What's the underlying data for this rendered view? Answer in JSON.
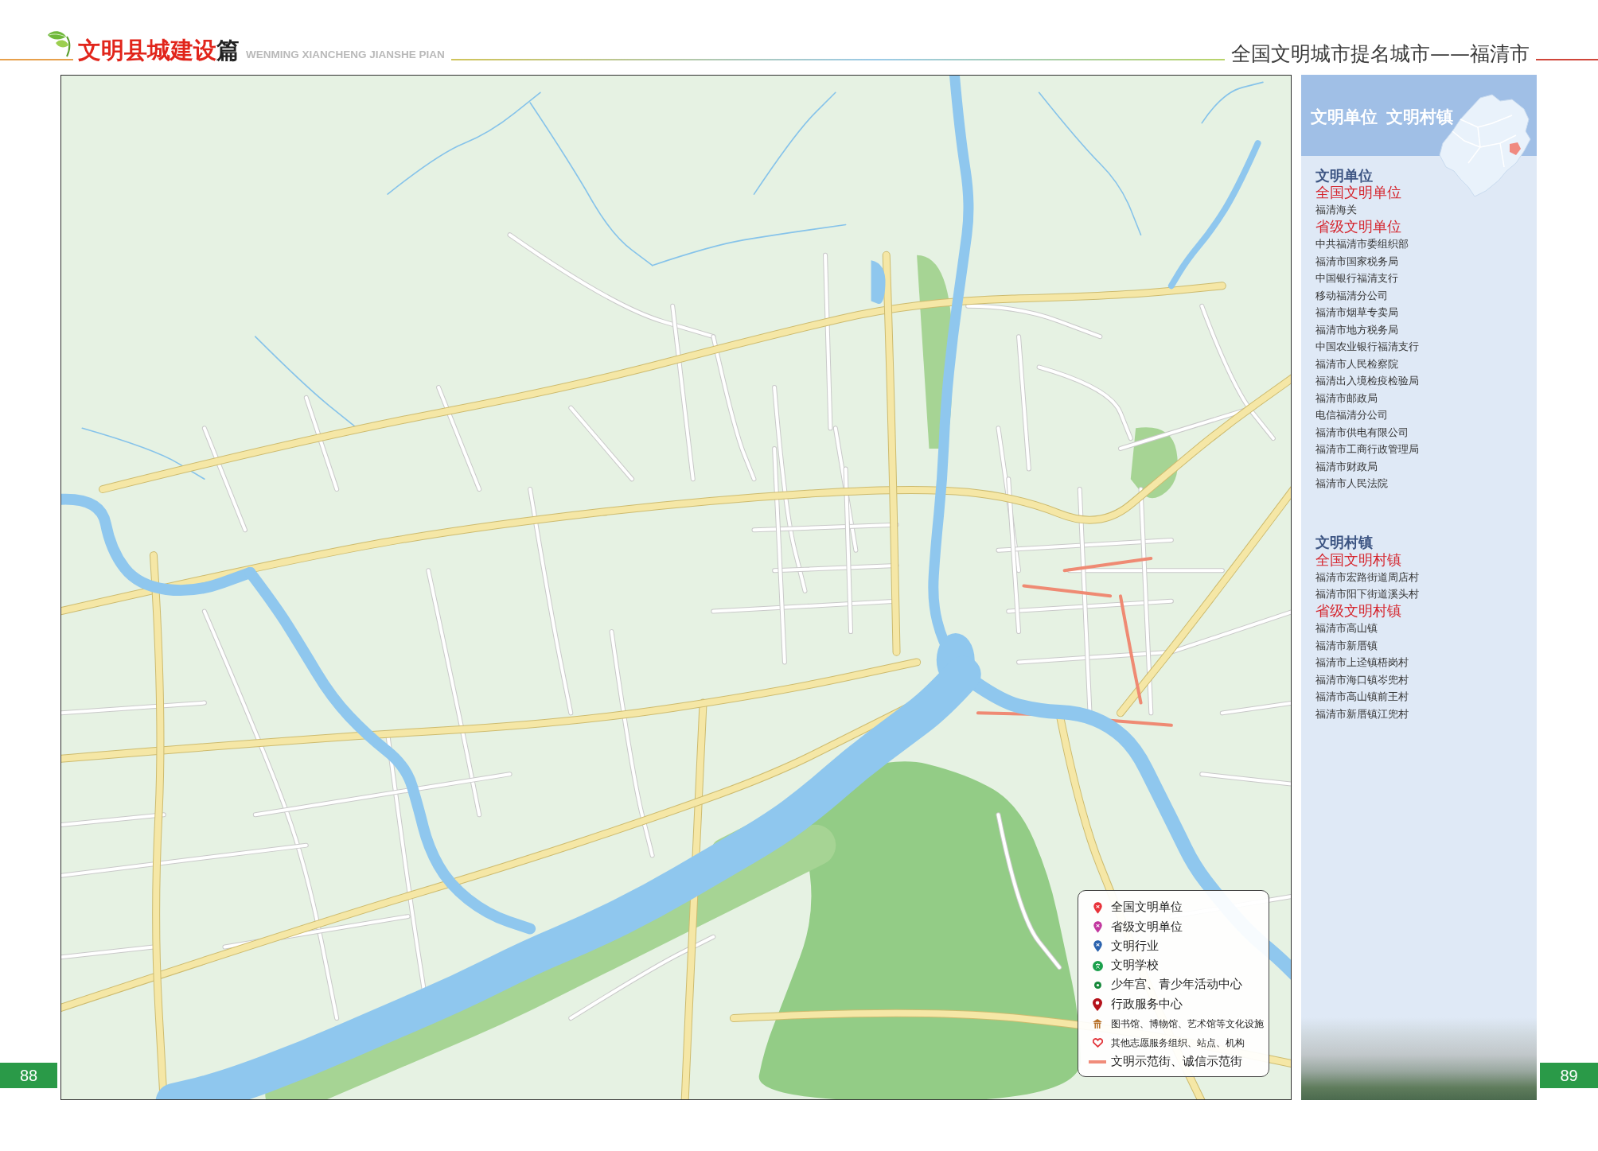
{
  "header": {
    "title": "文明县城建设",
    "title_suffix": "篇",
    "subtitle": "WENMING XIANCHENG JIANSHE PIAN",
    "right_title": "全国文明城市提名城市——福清市"
  },
  "page_numbers": [
    "88",
    "89"
  ],
  "map": {
    "legend": {
      "items": [
        {
          "kind": "badge",
          "color": "#e8323a",
          "label": "全国文明单位"
        },
        {
          "kind": "badge",
          "color": "#c2389f",
          "label": "省级文明单位"
        },
        {
          "kind": "badge",
          "color": "#2a62ae",
          "label": "文明行业"
        },
        {
          "kind": "school",
          "color": "#1ba04c",
          "label": "文明学校"
        },
        {
          "kind": "dot",
          "color": "#16883a",
          "label": "少年宫、青少年活动中心"
        },
        {
          "kind": "pin",
          "color": "#b5121b",
          "label": "行政服务中心"
        },
        {
          "kind": "culture",
          "color": "#b8732b",
          "label": "图书馆、博物馆、艺术馆等文化设施"
        },
        {
          "kind": "heart",
          "color": "#e2343a",
          "label": "其他志愿服务组织、站点、机构"
        },
        {
          "kind": "line",
          "color": "#f08c7a",
          "label": "文明示范街、诚信示范街"
        }
      ]
    }
  },
  "sidebar": {
    "titles": [
      "文明单位",
      "文明村镇"
    ],
    "sections": [
      {
        "heading": "文明单位",
        "groups": [
          {
            "heading": "全国文明单位",
            "items": [
              "福清海关"
            ]
          },
          {
            "heading": "省级文明单位",
            "items": [
              "中共福清市委组织部",
              "福清市国家税务局",
              "中国银行福清支行",
              "移动福清分公司",
              "福清市烟草专卖局",
              "福清市地方税务局",
              "中国农业银行福清支行",
              "福清市人民检察院",
              "福清出入境检疫检验局",
              "福清市邮政局",
              "电信福清分公司",
              "福清市供电有限公司",
              "福清市工商行政管理局",
              "福清市财政局",
              "福清市人民法院"
            ]
          }
        ]
      },
      {
        "heading": "文明村镇",
        "groups": [
          {
            "heading": "全国文明村镇",
            "items": [
              "福清市宏路街道周店村",
              "福清市阳下街道溪头村"
            ]
          },
          {
            "heading": "省级文明村镇",
            "items": [
              "福清市高山镇",
              "福清市新厝镇",
              "福清市上迳镇梧岗村",
              "福清市海口镇岑兜村",
              "福清市高山镇前王村",
              "福清市新厝镇江兜村"
            ]
          }
        ]
      }
    ]
  }
}
